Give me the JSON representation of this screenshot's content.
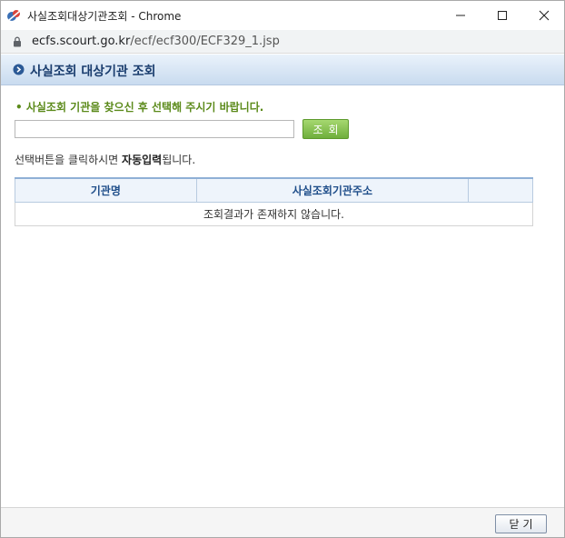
{
  "window": {
    "title": "사실조회대상기관조회 - Chrome"
  },
  "urlbar": {
    "host": "ecfs.scourt.go.kr",
    "path": "/ecf/ecf300/ECF329_1.jsp"
  },
  "header": {
    "title": "사실조회 대상기관 조회"
  },
  "search": {
    "notice": "• 사실조회 기관을 찾으신 후 선택해 주시기 바랍니다.",
    "input_value": "",
    "button_label": "조회"
  },
  "help": {
    "prefix": "선택버튼을 클릭하시면 ",
    "bold": "자동입력",
    "suffix": "됩니다."
  },
  "table": {
    "columns": [
      "기관명",
      "사실조회기관주소",
      ""
    ],
    "empty_message": "조회결과가 존재하지 않습니다."
  },
  "footer": {
    "close_label": "닫기"
  },
  "colors": {
    "header_title": "#1a3d6e",
    "notice": "#5b8a1a",
    "search_button": "#6fae3c",
    "table_header_text": "#1f4e8a"
  }
}
